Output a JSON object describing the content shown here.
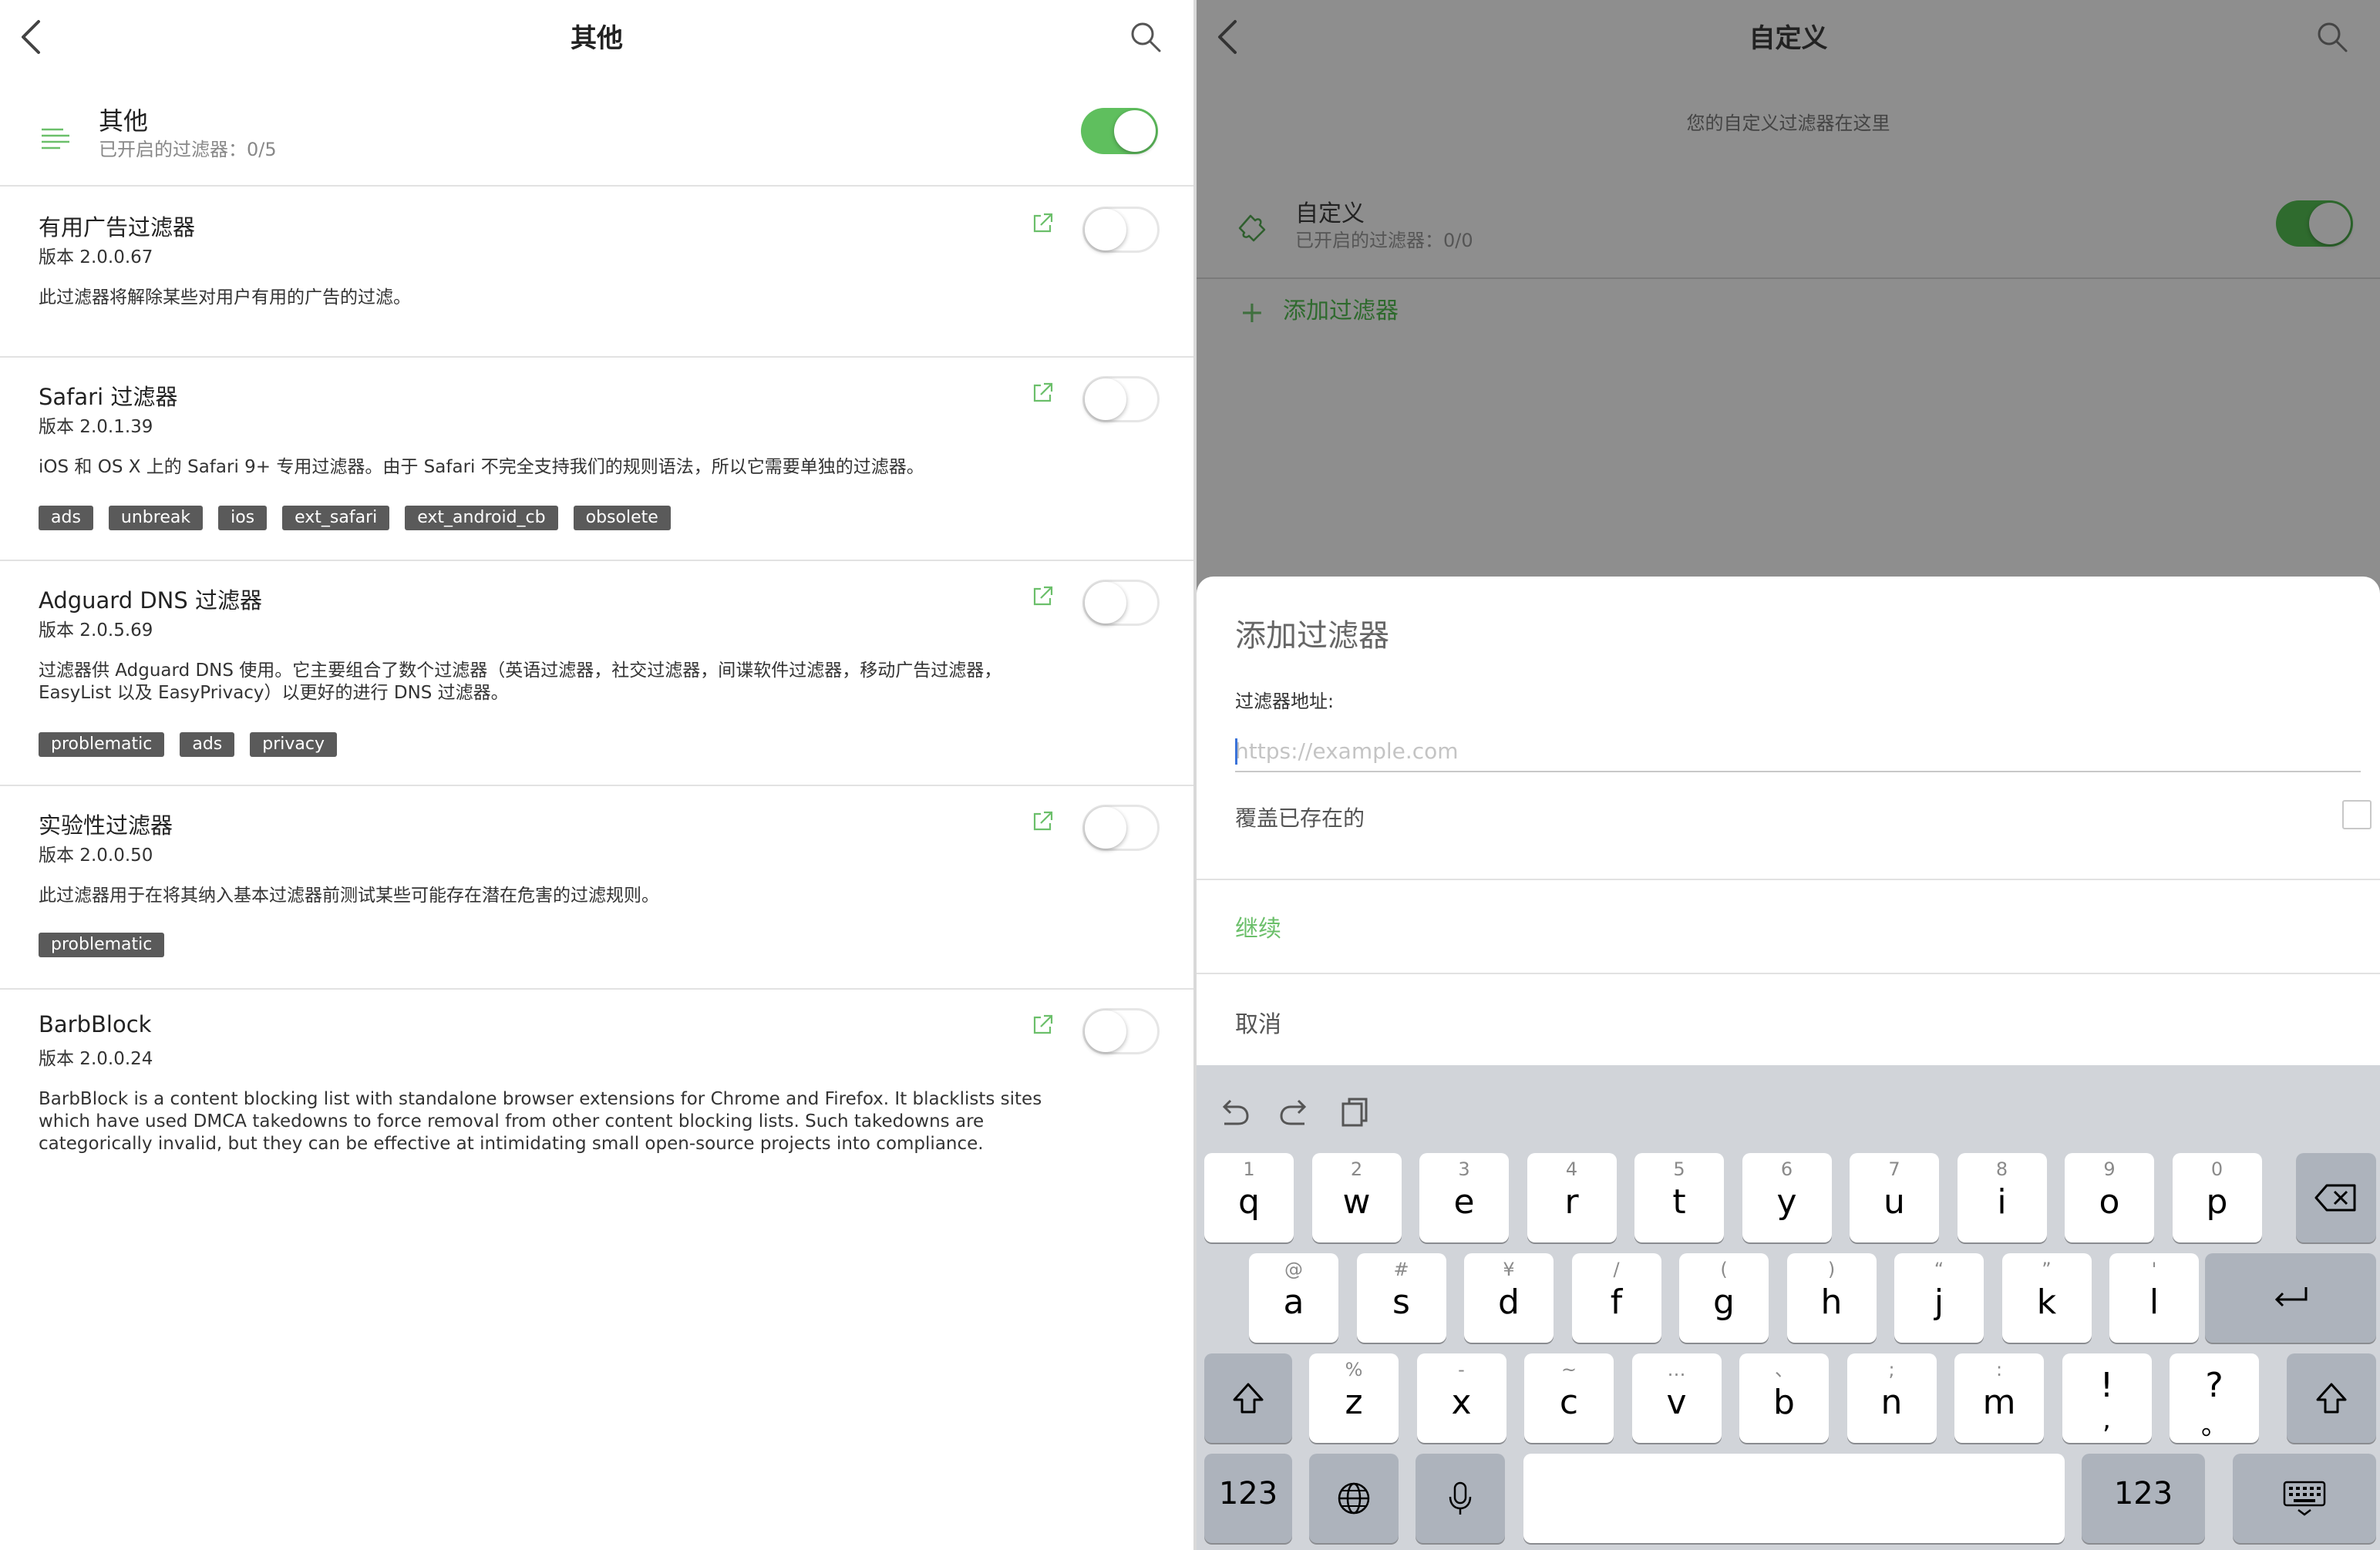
{
  "left": {
    "nav_title": "其他",
    "group": {
      "title": "其他",
      "subtitle": "已开启的过滤器：0/5",
      "enabled": true
    },
    "filters": [
      {
        "title": "有用广告过滤器",
        "version": "版本 2.0.0.67",
        "description": "此过滤器将解除某些对用户有用的广告的过滤。",
        "tags": [],
        "enabled": false
      },
      {
        "title": "Safari  过滤器",
        "version": "版本 2.0.1.39",
        "description": "iOS 和 OS X 上的 Safari 9+ 专用过滤器。由于 Safari 不完全支持我们的规则语法，所以它需要单独的过滤器。",
        "tags": [
          "ads",
          "unbreak",
          "ios",
          "ext_safari",
          "ext_android_cb",
          "obsolete"
        ],
        "enabled": false
      },
      {
        "title": "Adguard DNS 过滤器",
        "version": "版本 2.0.5.69",
        "description": "过滤器供 Adguard DNS 使用。它主要组合了数个过滤器（英语过滤器，社交过滤器，间谍软件过滤器，移动广告过滤器，EasyList 以及 EasyPrivacy）以更好的进行 DNS 过滤器。",
        "tags": [
          "problematic",
          "ads",
          "privacy"
        ],
        "enabled": false
      },
      {
        "title": "实验性过滤器",
        "version": "版本 2.0.0.50",
        "description": "此过滤器用于在将其纳入基本过滤器前测试某些可能存在潜在危害的过滤规则。",
        "tags": [
          "problematic"
        ],
        "enabled": false
      },
      {
        "title": "BarbBlock",
        "version": "版本 2.0.0.24",
        "description": "BarbBlock is a content blocking list with standalone browser extensions for Chrome and Firefox. It blacklists sites which have used DMCA takedowns to force removal from other content blocking lists. Such takedowns are categorically invalid, but they can be effective at intimidating small open-source projects into compliance.",
        "tags": [],
        "enabled": false
      }
    ]
  },
  "right": {
    "nav_title": "自定义",
    "subtitle": "您的自定义过滤器在这里",
    "group": {
      "title": "自定义",
      "subtitle": "已开启的过滤器：0/0",
      "enabled": true
    },
    "add_filter_label": "添加过滤器",
    "sheet": {
      "title": "添加过滤器",
      "field_label": "过滤器地址:",
      "url_placeholder": "https://example.com",
      "url_value": "",
      "overwrite_label": "覆盖已存在的",
      "overwrite_checked": false,
      "continue_label": "继续",
      "cancel_label": "取消"
    },
    "keyboard": {
      "row1": [
        {
          "k": "q",
          "h": "1"
        },
        {
          "k": "w",
          "h": "2"
        },
        {
          "k": "e",
          "h": "3"
        },
        {
          "k": "r",
          "h": "4"
        },
        {
          "k": "t",
          "h": "5"
        },
        {
          "k": "y",
          "h": "6"
        },
        {
          "k": "u",
          "h": "7"
        },
        {
          "k": "i",
          "h": "8"
        },
        {
          "k": "o",
          "h": "9"
        },
        {
          "k": "p",
          "h": "0"
        }
      ],
      "row2": [
        {
          "k": "a",
          "h": "@"
        },
        {
          "k": "s",
          "h": "#"
        },
        {
          "k": "d",
          "h": "¥"
        },
        {
          "k": "f",
          "h": "/"
        },
        {
          "k": "g",
          "h": "("
        },
        {
          "k": "h",
          "h": ")"
        },
        {
          "k": "j",
          "h": "“"
        },
        {
          "k": "k",
          "h": "”"
        },
        {
          "k": "l",
          "h": "'"
        }
      ],
      "row3": [
        {
          "k": "z",
          "h": "%"
        },
        {
          "k": "x",
          "h": "-"
        },
        {
          "k": "c",
          "h": "~"
        },
        {
          "k": "v",
          "h": "…"
        },
        {
          "k": "b",
          "h": "、"
        },
        {
          "k": "n",
          "h": ";"
        },
        {
          "k": "m",
          "h": ":"
        },
        {
          "k": "!",
          "h": "",
          "sub": ","
        },
        {
          "k": "?",
          "h": "",
          "sub": "。"
        }
      ],
      "numbers_label": "123"
    }
  },
  "colors": {
    "accent_green": "#5fbf5e",
    "tag_bg": "#5a5a5a",
    "dim_overlay": "#8e8e8e",
    "keyboard_bg": "#d1d4d9"
  }
}
